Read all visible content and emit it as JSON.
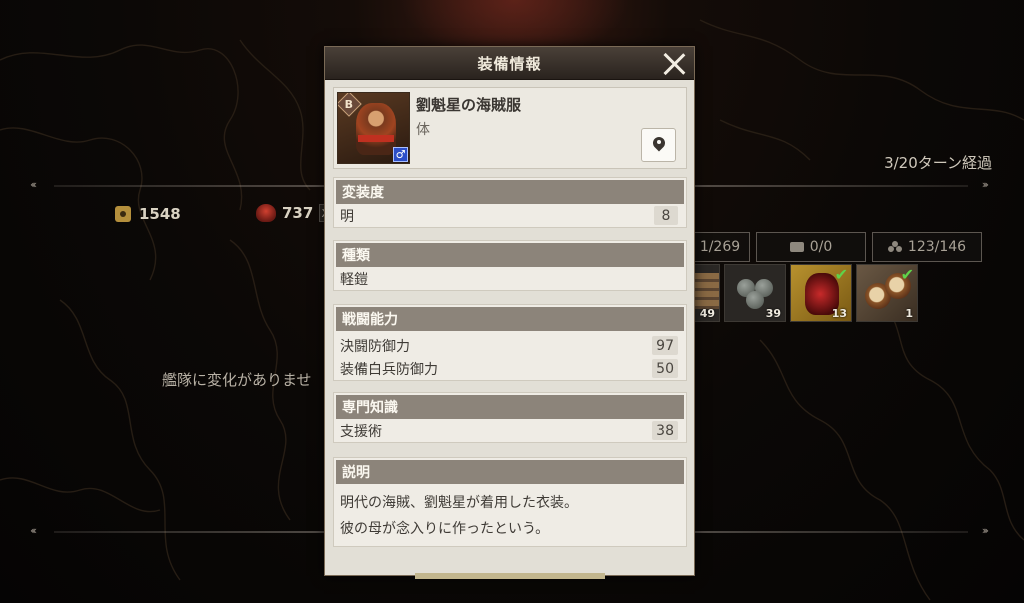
{
  "modal": {
    "title": "装備情報",
    "item": {
      "name": "劉魁星の海賊服",
      "slot": "体",
      "rank": "B",
      "gender_symbol": "♂"
    },
    "sections": [
      {
        "heading": "変装度",
        "rows": [
          {
            "label": "明",
            "value": "8"
          }
        ]
      },
      {
        "heading": "種類",
        "rows": [
          {
            "label": "軽鎧",
            "value": ""
          }
        ]
      },
      {
        "heading": "戦闘能力",
        "rows": [
          {
            "label": "決闘防御力",
            "value": "97"
          },
          {
            "label": "装備白兵防御力",
            "value": "50"
          }
        ]
      },
      {
        "heading": "専門知識",
        "rows": [
          {
            "label": "支援術",
            "value": "38"
          }
        ]
      }
    ],
    "description": {
      "heading": "説明",
      "lines": [
        "明代の海賊、劉魁星が着用した衣装。",
        "彼の母が念入りに作ったという。"
      ]
    }
  },
  "background": {
    "turn_status": "3/20ターン経過",
    "gold": "1548",
    "crew": "737",
    "crew_suffix": "X",
    "fleet_message": "艦隊に変化がありませ",
    "stat_boxes": [
      "1/269",
      "0/0",
      "123/146"
    ],
    "items": [
      {
        "name": "wood",
        "qty": "49",
        "checked": false
      },
      {
        "name": "stones",
        "qty": "39",
        "checked": false
      },
      {
        "name": "wine-jar",
        "qty": "13",
        "checked": true
      },
      {
        "name": "nuts",
        "qty": "1",
        "checked": true
      }
    ]
  },
  "colors": {
    "modal_bg": "#e2dfd6",
    "section_header": "#8c847a",
    "header_bar": "#2a231e",
    "check_green": "#5fd34a"
  }
}
